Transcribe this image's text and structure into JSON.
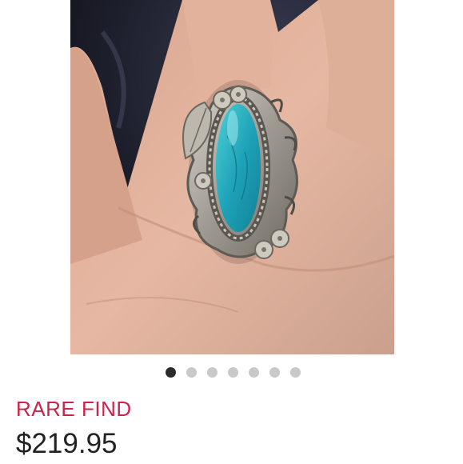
{
  "listing": {
    "badge_text": "RARE FIND",
    "badge_color": "#c8254a",
    "price": "$219.95"
  },
  "carousel": {
    "dot_count": 7,
    "active_index": 0
  },
  "image": {
    "subject": "turquoise-silver-ring-on-hand"
  }
}
